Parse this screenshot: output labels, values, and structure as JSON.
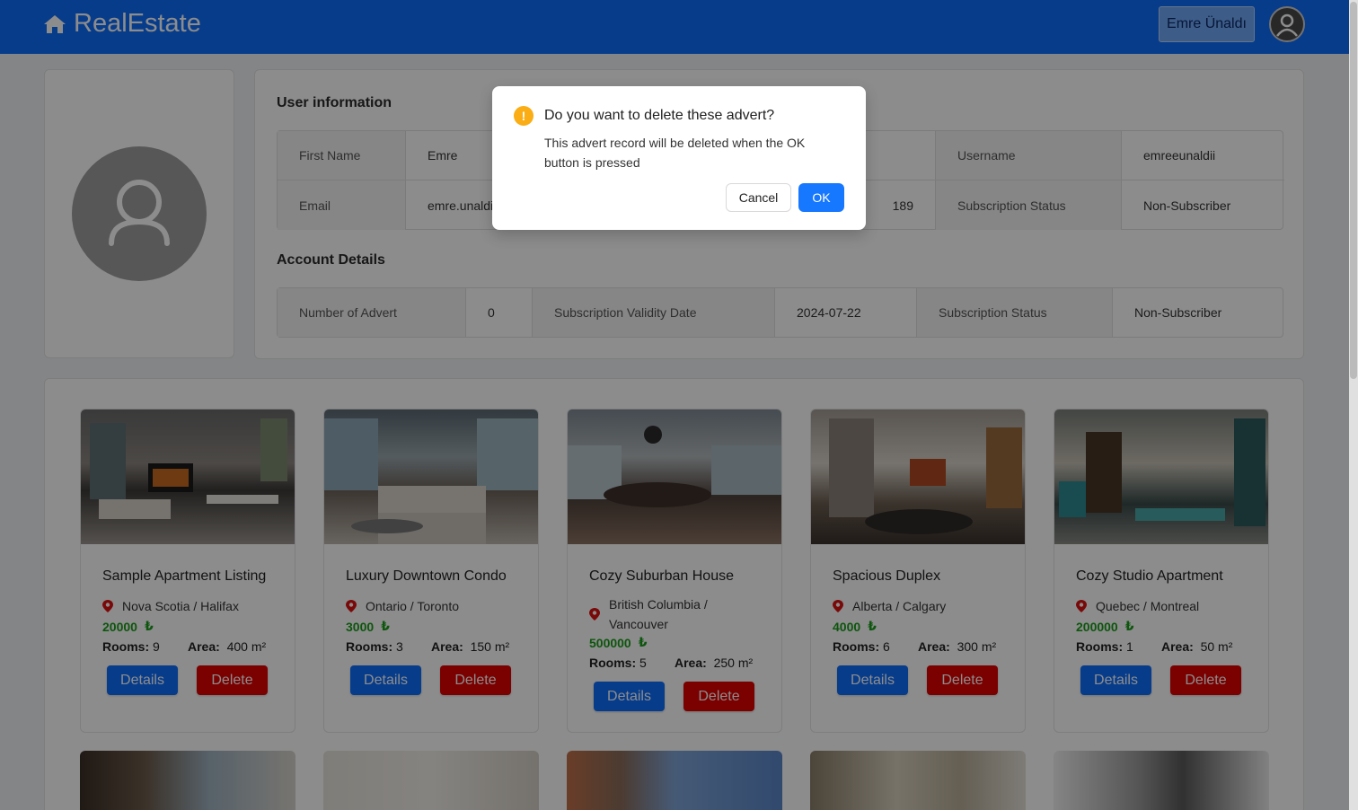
{
  "header": {
    "brand": "RealEstate",
    "user_button": "Emre Ünaldı",
    "brand_color": "#0d6efd"
  },
  "user_info": {
    "title": "User information",
    "rows": [
      [
        {
          "label": "First Name",
          "value": "Emre"
        },
        {
          "label": "",
          "value": ""
        },
        {
          "label": "Username",
          "value": "emreeunaldii"
        }
      ],
      [
        {
          "label": "Email",
          "value": "emre.unaldi"
        },
        {
          "label": "",
          "value": "189"
        },
        {
          "label": "Subscription Status",
          "value": "Non-Subscriber"
        }
      ]
    ]
  },
  "account": {
    "title": "Account Details",
    "number_of_advert_label": "Number of Advert",
    "number_of_advert": "0",
    "validity_label": "Subscription Validity Date",
    "validity": "2024-07-22",
    "status_label": "Subscription Status",
    "status": "Non-Subscriber"
  },
  "listings": [
    {
      "title": "Sample Apartment Listing",
      "location": "Nova Scotia / Halifax",
      "price": "20000",
      "currency": "₺",
      "rooms_label": "Rooms:",
      "rooms": "9",
      "area_label": "Area:",
      "area": "400 m²",
      "details": "Details",
      "delete": "Delete"
    },
    {
      "title": "Luxury Downtown Condo",
      "location": "Ontario / Toronto",
      "price": "3000",
      "currency": "₺",
      "rooms_label": "Rooms:",
      "rooms": "3",
      "area_label": "Area:",
      "area": "150 m²",
      "details": "Details",
      "delete": "Delete"
    },
    {
      "title": "Cozy Suburban House",
      "location": "British Columbia / Vancouver",
      "price": "500000",
      "currency": "₺",
      "rooms_label": "Rooms:",
      "rooms": "5",
      "area_label": "Area:",
      "area": "250 m²",
      "details": "Details",
      "delete": "Delete"
    },
    {
      "title": "Spacious Duplex",
      "location": "Alberta / Calgary",
      "price": "4000",
      "currency": "₺",
      "rooms_label": "Rooms:",
      "rooms": "6",
      "area_label": "Area:",
      "area": "300 m²",
      "details": "Details",
      "delete": "Delete"
    },
    {
      "title": "Cozy Studio Apartment",
      "location": "Quebec / Montreal",
      "price": "200000",
      "currency": "₺",
      "rooms_label": "Rooms:",
      "rooms": "1",
      "area_label": "Area:",
      "area": "50 m²",
      "details": "Details",
      "delete": "Delete"
    }
  ],
  "modal": {
    "title": "Do you want to delete these advert?",
    "body": "This advert record will be deleted when the OK button is pressed",
    "cancel": "Cancel",
    "ok": "OK",
    "icon": "warning-icon"
  }
}
